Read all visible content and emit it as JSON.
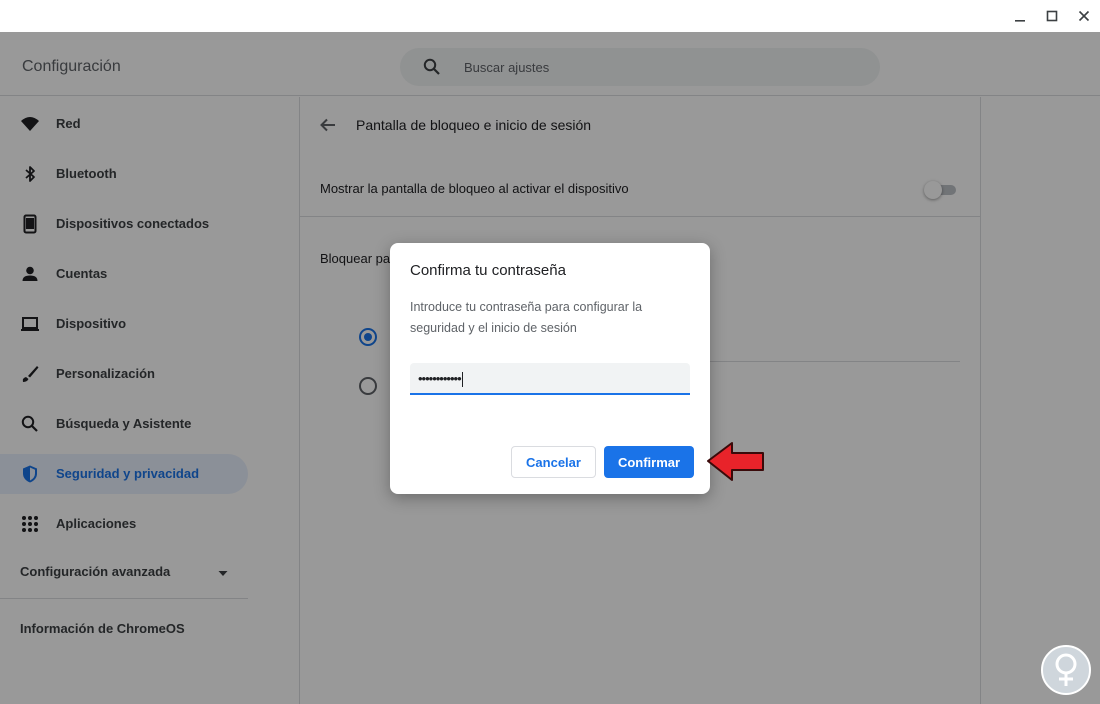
{
  "window": {
    "controls": {
      "minimize": "minimize-icon",
      "maximize": "maximize-icon",
      "close": "close-icon"
    }
  },
  "header": {
    "title": "Configuración",
    "search_placeholder": "Buscar ajustes",
    "search_icon": "search-icon"
  },
  "sidebar": {
    "items": [
      {
        "label": "Red",
        "icon": "wifi-icon",
        "active": false
      },
      {
        "label": "Bluetooth",
        "icon": "bluetooth-icon",
        "active": false
      },
      {
        "label": "Dispositivos conectados",
        "icon": "phone-icon",
        "active": false
      },
      {
        "label": "Cuentas",
        "icon": "person-icon",
        "active": false
      },
      {
        "label": "Dispositivo",
        "icon": "laptop-icon",
        "active": false
      },
      {
        "label": "Personalización",
        "icon": "brush-icon",
        "active": false
      },
      {
        "label": "Búsqueda y Asistente",
        "icon": "search-icon",
        "active": false
      },
      {
        "label": "Seguridad y privacidad",
        "icon": "shield-icon",
        "active": true
      },
      {
        "label": "Aplicaciones",
        "icon": "apps-grid-icon",
        "active": false
      }
    ],
    "advanced_label": "Configuración avanzada",
    "about_label": "Información de ChromeOS"
  },
  "main": {
    "page_title": "Pantalla de bloqueo e inicio de sesión",
    "show_lock_screen_label": "Mostrar la pantalla de bloqueo al activar el dispositivo",
    "show_lock_screen_on": false,
    "lock_with_label": "Bloquear par",
    "radio_options_selected_index": 0
  },
  "dialog": {
    "title": "Confirma tu contraseña",
    "description": "Introduce tu contraseña para configurar la seguridad y el inicio de sesión",
    "password_value": "••••••••••••",
    "cancel_label": "Cancelar",
    "confirm_label": "Confirmar"
  },
  "colors": {
    "accent": "#1a73e8",
    "annotation_arrow": "#e8232a",
    "active_nav_bg": "#e8f0fe"
  }
}
